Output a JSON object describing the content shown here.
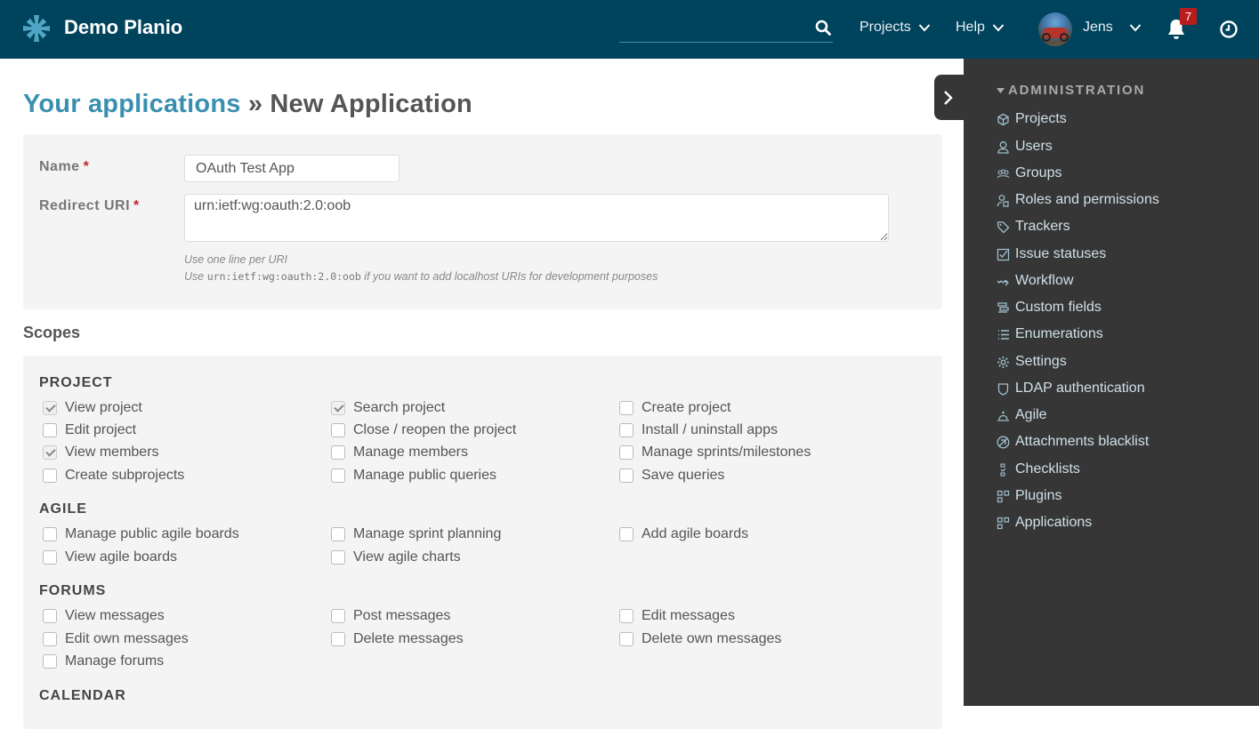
{
  "header": {
    "app_title": "Demo Planio",
    "search": {
      "value": "",
      "placeholder": ""
    },
    "nav": [
      {
        "label": "Projects"
      },
      {
        "label": "Help"
      }
    ],
    "user_name": "Jens",
    "notifications_count": "7"
  },
  "page": {
    "breadcrumb_link": "Your applications",
    "separator": " » ",
    "title": "New Application"
  },
  "form": {
    "name_label": "Name",
    "name_value": "OAuth Test App",
    "redirect_label": "Redirect URI",
    "redirect_value": "urn:ietf:wg:oauth:2.0:oob",
    "required_marker": "*",
    "hint_line1": "Use one line per URI",
    "hint_line2_prefix": "Use",
    "hint_line2_code": "urn:ietf:wg:oauth:2.0:oob",
    "hint_line2_suffix": "if you want to add localhost URIs for development purposes"
  },
  "scopes": {
    "title": "Scopes",
    "sections": [
      {
        "heading": "PROJECT",
        "items": [
          {
            "label": "View project",
            "checked": true
          },
          {
            "label": "Search project",
            "checked": true
          },
          {
            "label": "Create project",
            "checked": false
          },
          {
            "label": "Edit project",
            "checked": false
          },
          {
            "label": "Close / reopen the project",
            "checked": false
          },
          {
            "label": "Install / uninstall apps",
            "checked": false
          },
          {
            "label": "View members",
            "checked": true
          },
          {
            "label": "Manage members",
            "checked": false
          },
          {
            "label": "Manage sprints/milestones",
            "checked": false
          },
          {
            "label": "Create subprojects",
            "checked": false
          },
          {
            "label": "Manage public queries",
            "checked": false
          },
          {
            "label": "Save queries",
            "checked": false
          }
        ]
      },
      {
        "heading": "AGILE",
        "items": [
          {
            "label": "Manage public agile boards",
            "checked": false
          },
          {
            "label": "Manage sprint planning",
            "checked": false
          },
          {
            "label": "Add agile boards",
            "checked": false
          },
          {
            "label": "View agile boards",
            "checked": false
          },
          {
            "label": "View agile charts",
            "checked": false
          }
        ]
      },
      {
        "heading": "FORUMS",
        "items": [
          {
            "label": "View messages",
            "checked": false
          },
          {
            "label": "Post messages",
            "checked": false
          },
          {
            "label": "Edit messages",
            "checked": false
          },
          {
            "label": "Edit own messages",
            "checked": false
          },
          {
            "label": "Delete messages",
            "checked": false
          },
          {
            "label": "Delete own messages",
            "checked": false
          },
          {
            "label": "Manage forums",
            "checked": false
          }
        ]
      },
      {
        "heading": "CALENDAR",
        "items": []
      }
    ]
  },
  "sidebar": {
    "heading": "ADMINISTRATION",
    "items": [
      {
        "label": "Projects",
        "icon": "cube-icon"
      },
      {
        "label": "Users",
        "icon": "user-icon"
      },
      {
        "label": "Groups",
        "icon": "group-icon"
      },
      {
        "label": "Roles and permissions",
        "icon": "roles-icon"
      },
      {
        "label": "Trackers",
        "icon": "tag-icon"
      },
      {
        "label": "Issue statuses",
        "icon": "checkbox-icon"
      },
      {
        "label": "Workflow",
        "icon": "workflow-icon"
      },
      {
        "label": "Custom fields",
        "icon": "custom-fields-icon"
      },
      {
        "label": "Enumerations",
        "icon": "list-icon"
      },
      {
        "label": "Settings",
        "icon": "gear-icon"
      },
      {
        "label": "LDAP authentication",
        "icon": "shield-icon"
      },
      {
        "label": "Agile",
        "icon": "agile-icon"
      },
      {
        "label": "Attachments blacklist",
        "icon": "blocked-attachment-icon"
      },
      {
        "label": "Checklists",
        "icon": "checklist-icon"
      },
      {
        "label": "Plugins",
        "icon": "plugins-icon"
      },
      {
        "label": "Applications",
        "icon": "applications-icon"
      }
    ]
  },
  "colors": {
    "header_bg": "#00435c",
    "accent_link": "#3a8fb0",
    "sidebar_bg": "#363636",
    "required": "#c0272d",
    "badge": "#b81c1c"
  }
}
